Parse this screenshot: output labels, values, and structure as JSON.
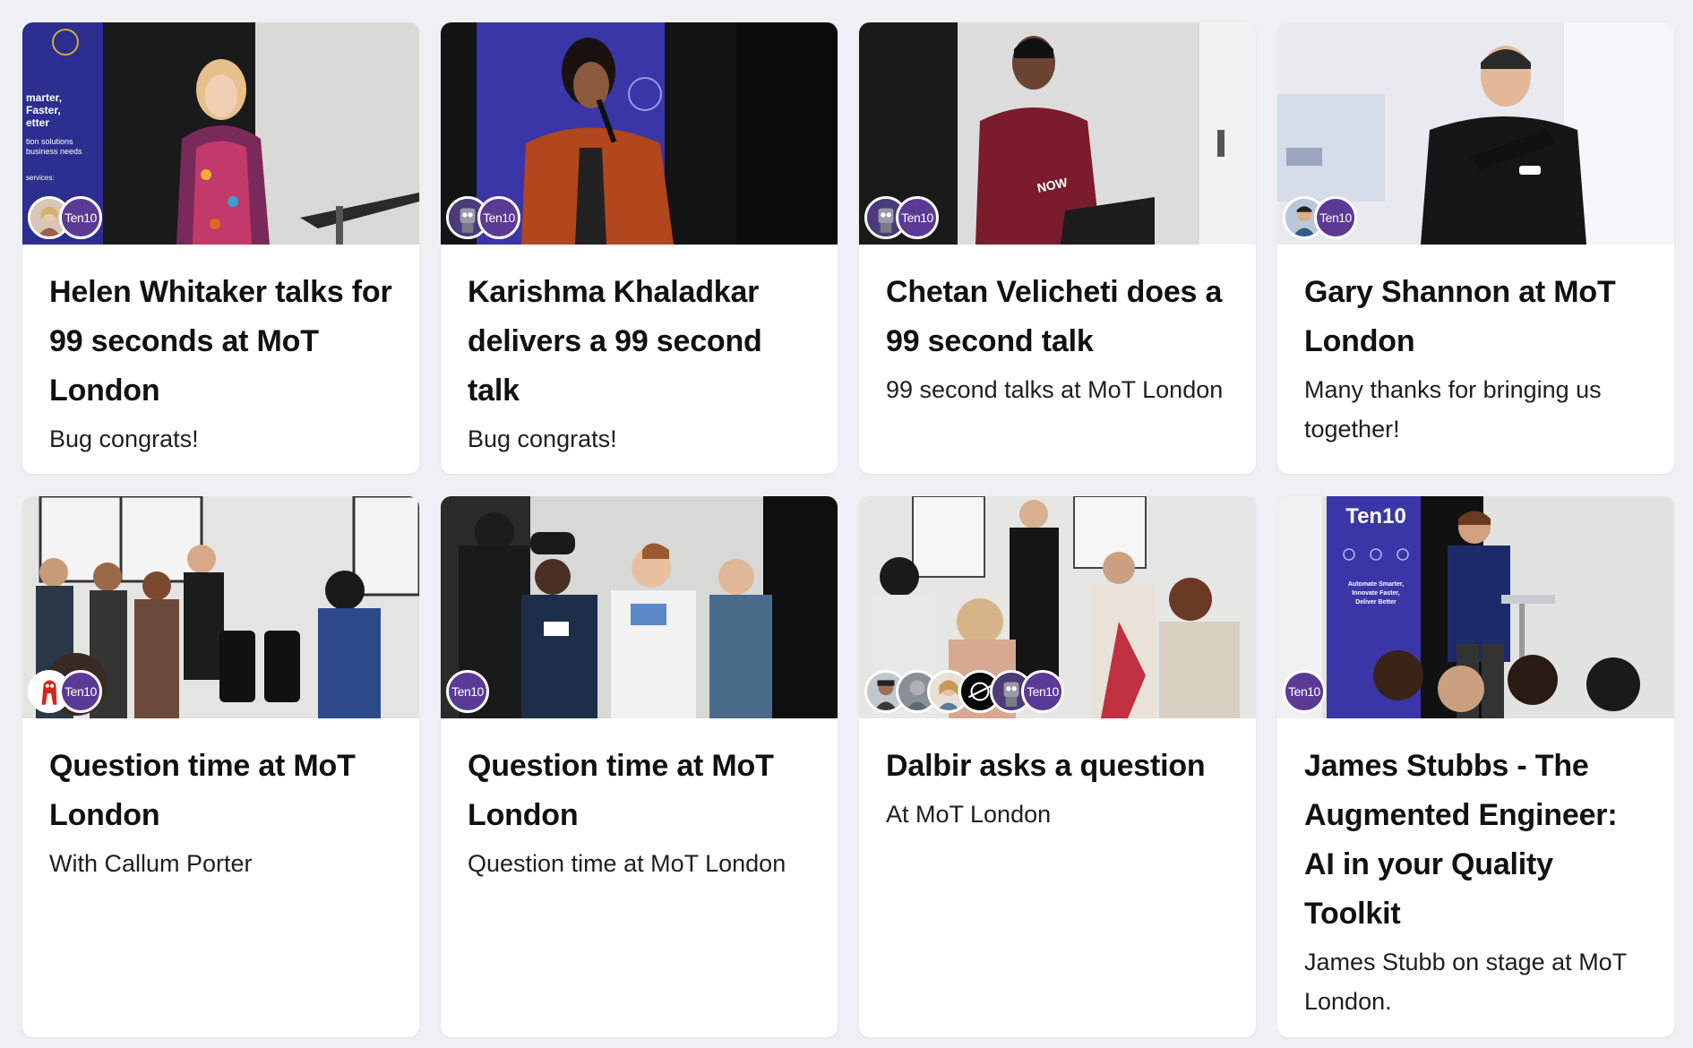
{
  "org_badge_label": "Ten10",
  "cards": [
    {
      "title": "Helen Whitaker talks for 99 seconds at MoT London",
      "subtitle": "Bug congrats!"
    },
    {
      "title": "Karishma Khaladkar delivers a 99 second talk",
      "subtitle": "Bug congrats!"
    },
    {
      "title": "Chetan Velicheti does a 99 second talk",
      "subtitle": "99 second talks at MoT London"
    },
    {
      "title": "Gary Shannon at MoT London",
      "subtitle": "Many thanks for bringing us together!"
    },
    {
      "title": "Question time at MoT London",
      "subtitle": "With Callum Porter"
    },
    {
      "title": "Question time at MoT London",
      "subtitle": "Question time at MoT London"
    },
    {
      "title": "Dalbir asks a question",
      "subtitle": "At MoT London"
    },
    {
      "title": "James Stubbs - The Augmented Engineer: AI in your Quality Toolkit",
      "subtitle": "James Stubb on stage at MoT London."
    }
  ],
  "banner_texts": {
    "card1": [
      "marter,",
      "Faster,",
      "etter",
      "tion solutions",
      "business needs",
      "services:"
    ],
    "card8": [
      "Ten10",
      "Automate Smarter,",
      "Innovate Faster,",
      "Deliver Better"
    ]
  },
  "colors": {
    "page_bg": "#eef0f3",
    "card_bg": "#ffffff",
    "brand_purple": "#5b3a96",
    "banner_blue": "#3a36a8"
  }
}
